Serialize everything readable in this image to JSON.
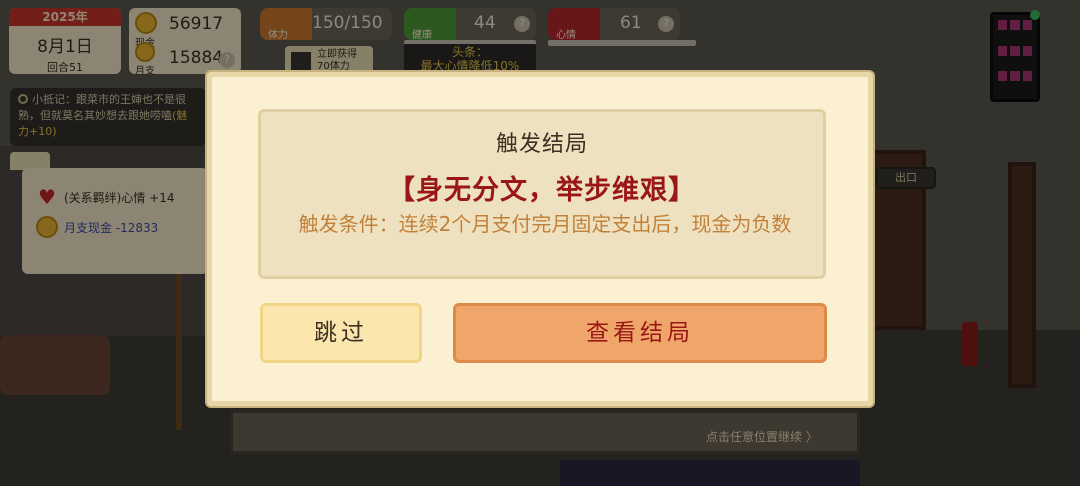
{
  "hud": {
    "date": {
      "year": "2025年",
      "day": "8月1日",
      "round": "回合51"
    },
    "money": {
      "cash_label": "现金",
      "cash_value": "56917",
      "monthly_label": "月支",
      "monthly_value": "15884"
    },
    "stats": {
      "stamina": {
        "label": "体力",
        "value": "150/150"
      },
      "health": {
        "label": "健康",
        "value": "44"
      },
      "mood": {
        "label": "心情",
        "value": "61"
      }
    },
    "video": {
      "line1": "立即获得",
      "line2": "70体力"
    },
    "headline": {
      "line1": "头条：",
      "line2": "最大心情降低10%"
    },
    "help_glyph": "?"
  },
  "diary": {
    "text": "小抵记：跟菜市的王婶也不是很熟，但就莫名其妙想去跟她唠嗑",
    "bonus": "(魅力+10)"
  },
  "notes": {
    "mood_change": "(关系羁绊)心情 +14",
    "cash_change": "月支现金 -12833"
  },
  "scene": {
    "exit_sign": "出口",
    "continue_hint": "点击任意位置继续 〉"
  },
  "modal": {
    "title": "触发结局",
    "ending_name": "【身无分文，举步维艰】",
    "condition": "触发条件：连续2个月支付完月固定支出后，现金为负数",
    "skip_label": "跳过",
    "view_label": "查看结局"
  },
  "colors": {
    "accent_red": "#9a1717",
    "button_orange": "#f0a66a",
    "panel_cream": "#fbf1d2",
    "condition_text": "#c2813a"
  }
}
